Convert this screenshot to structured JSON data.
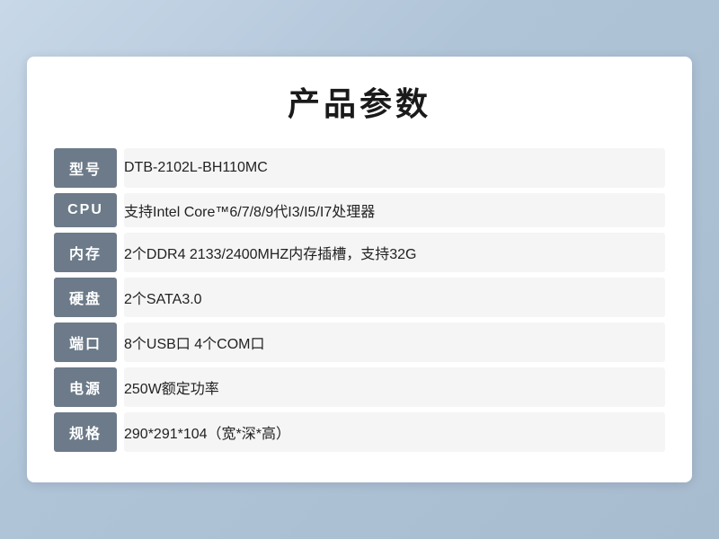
{
  "page": {
    "title": "产品参数",
    "background": "#c8d8e8"
  },
  "specs": [
    {
      "label": "型号",
      "value": " DTB-2102L-BH110MC"
    },
    {
      "label": "CPU",
      "value": "支持Intel Core™6/7/8/9代I3/I5/I7处理器"
    },
    {
      "label": "内存",
      "value": "2个DDR4 2133/2400MHZ内存插槽，支持32G"
    },
    {
      "label": "硬盘",
      "value": "2个SATA3.0"
    },
    {
      "label": "端口",
      "value": "8个USB口 4个COM口"
    },
    {
      "label": "电源",
      "value": "250W额定功率"
    },
    {
      "label": "规格",
      "value": "290*291*104（宽*深*高）"
    }
  ]
}
